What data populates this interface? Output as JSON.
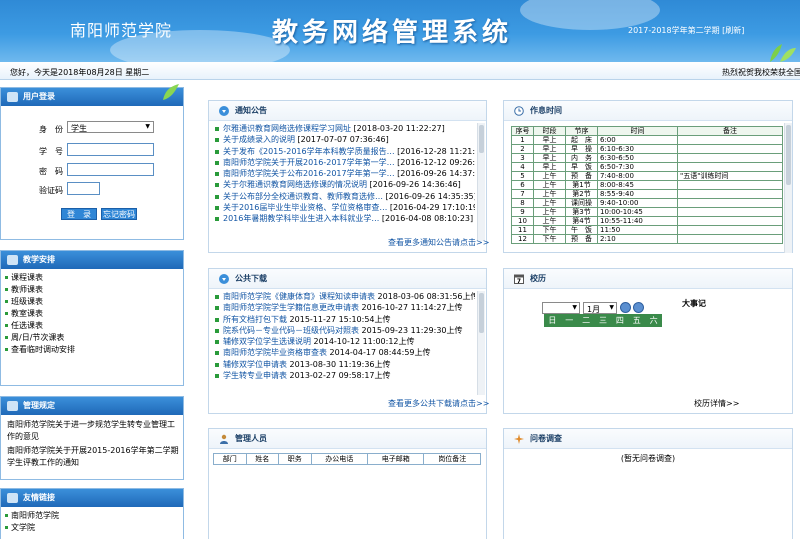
{
  "header": {
    "school": "南阳师范学院",
    "title": "教务网络管理系统",
    "term": "2017-2018学年第二学期 [刷新]"
  },
  "datebar": {
    "today": "您好，今天是2018年08月28日 星期二",
    "marquee": "热烈祝贺我校荣获全国"
  },
  "login": {
    "title": "用户登录",
    "identity_label": "身　份",
    "identity_value": "学生",
    "id_label": "学　号",
    "pwd_label": "密　码",
    "code_label": "验证码",
    "login_btn": "登　录",
    "forgot_btn": "忘记密码"
  },
  "teaching": {
    "title": "教学安排",
    "items": [
      "课程课表",
      "教师课表",
      "班级课表",
      "教室课表",
      "任选课表",
      "周/日/节次课表",
      "查看临时调动安排"
    ]
  },
  "rules": {
    "title": "管理规定",
    "items": [
      "南阳师范学院关于进一步规范学生转专业管理工作的意见",
      "南阳师范学院关于开展2015-2016学年第二学期学生评教工作的通知"
    ]
  },
  "links": {
    "title": "友情链接",
    "items": [
      "南阳师范学院",
      "文学院"
    ]
  },
  "notice": {
    "title": "通知公告",
    "items": [
      {
        "text": "尔雅通识教育网络选修课程学习网址",
        "date": "[2018-03-20 11:22:27]"
      },
      {
        "text": "关于成绩录入的说明",
        "date": "[2017-07-07 07:36:46]"
      },
      {
        "text": "关于发布《2015-2016学年本科教学质量报告…",
        "date": "[2016-12-28 11:21:54]"
      },
      {
        "text": "南阳师范学院关于开展2016-2017学年第一学…",
        "date": "[2016-12-12 09:26:31]"
      },
      {
        "text": "南阳师范学院关于公布2016-2017学年第一学…",
        "date": "[2016-09-26 14:37:28]"
      },
      {
        "text": "关于尔雅通识教育网络选修课的情况说明",
        "date": "[2016-09-26 14:36:46]"
      },
      {
        "text": "关于公布部分全校通识教育、教师教育选修…",
        "date": "[2016-09-26 14:35:35]"
      },
      {
        "text": "关于2016届毕业生毕业资格、学位资格审查…",
        "date": "[2016-04-29 17:10:19]"
      },
      {
        "text": "2016年暑期教学科毕业生进入本科就业学…",
        "date": "[2016-04-08 08:10:23]"
      }
    ],
    "more": "查看更多通知公告请点击>>"
  },
  "schedule": {
    "title": "作息时间",
    "headers": [
      "序号",
      "时段",
      "节序",
      "时间",
      "备注"
    ],
    "rows": [
      [
        "1",
        "早上",
        "起　床",
        "6:00",
        ""
      ],
      [
        "2",
        "早上",
        "早　操",
        "6:10-6:30",
        ""
      ],
      [
        "3",
        "早上",
        "内　务",
        "6:30-6:50",
        ""
      ],
      [
        "4",
        "早上",
        "早　饭",
        "6:50-7:30",
        ""
      ],
      [
        "5",
        "上午",
        "预　备",
        "7:40-8:00",
        "\"五语\"训练时间"
      ],
      [
        "6",
        "上午",
        "第1节",
        "8:00-8:45",
        ""
      ],
      [
        "7",
        "上午",
        "第2节",
        "8:55-9:40",
        ""
      ],
      [
        "8",
        "上午",
        "课间操",
        "9:40-10:00",
        ""
      ],
      [
        "9",
        "上午",
        "第3节",
        "10:00-10:45",
        ""
      ],
      [
        "10",
        "上午",
        "第4节",
        "10:55-11:40",
        ""
      ],
      [
        "11",
        "下午",
        "午　饭",
        "11:50",
        ""
      ],
      [
        "12",
        "下午",
        "预　备",
        "2:10",
        ""
      ]
    ]
  },
  "download": {
    "title": "公共下载",
    "items": [
      {
        "text": "南阳师范学院《健康体育》课程知读申请表",
        "date": "2018-03-06 08:31:56上传"
      },
      {
        "text": "南阳师范学院学生学籍信息更改申请表",
        "date": "2016-10-27 11:14:27上传"
      },
      {
        "text": "所有文档打包下载",
        "date": "2015-11-27 15:10:54上传"
      },
      {
        "text": "院系代码－专业代码－班级代码对照表",
        "date": "2015-09-23 11:29:30上传"
      },
      {
        "text": "辅修双学位学生选课说明",
        "date": "2014-10-12 11:00:12上传"
      },
      {
        "text": "南阳师范学院毕业资格审查表",
        "date": "2014-04-17 08:44:59上传"
      },
      {
        "text": "辅修双学位申请表",
        "date": "2013-08-30 11:19:36上传"
      },
      {
        "text": "学生转专业申请表",
        "date": "2013-02-27 09:58:17上传"
      }
    ],
    "more": "查看更多公共下载请点击>>"
  },
  "calendar": {
    "title": "校历",
    "month": "1月",
    "weekdays": [
      "日",
      "一",
      "二",
      "三",
      "四",
      "五",
      "六"
    ],
    "events_title": "大事记",
    "detail": "校历详情>>"
  },
  "admin": {
    "title": "管理人员",
    "headers": [
      "部门",
      "姓名",
      "职务",
      "办公电话",
      "电子邮箱",
      "岗位备注"
    ]
  },
  "survey": {
    "title": "问卷调查",
    "empty": "(暂无问卷调查)"
  }
}
